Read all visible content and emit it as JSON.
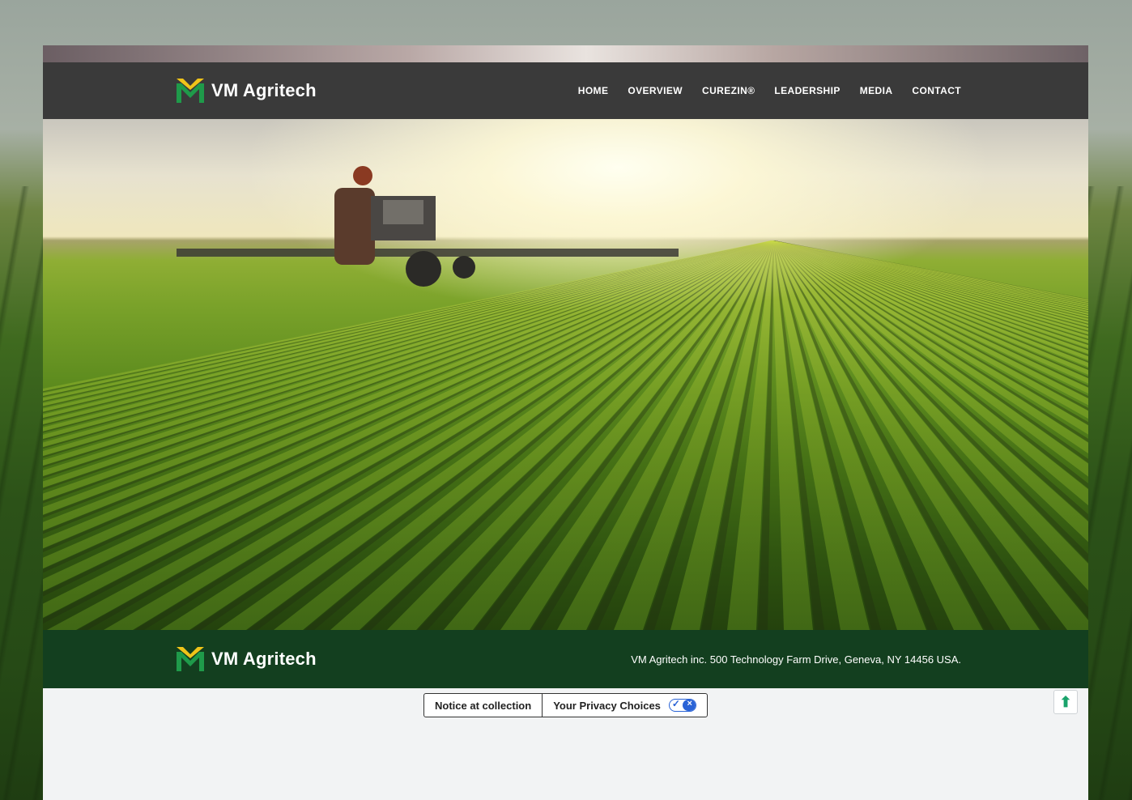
{
  "brand": {
    "name": "VM Agritech",
    "logo_icon": "vm-chevron-logo",
    "colors": {
      "green": "#1f9a4a",
      "yellow": "#f0c419"
    }
  },
  "nav": {
    "items": [
      {
        "label": "HOME"
      },
      {
        "label": "OVERVIEW"
      },
      {
        "label": "CUREZIN®"
      },
      {
        "label": "LEADERSHIP"
      },
      {
        "label": "MEDIA"
      },
      {
        "label": "CONTACT"
      }
    ]
  },
  "hero": {
    "image": "tractor-spraying-soybean-field"
  },
  "footer": {
    "brand_name": "VM Agritech",
    "address": "VM Agritech inc. 500 Technology Farm Drive, Geneva, NY 14456 USA.",
    "background": "#133f1f"
  },
  "privacy": {
    "notice_label": "Notice at collection",
    "choices_label": "Your Privacy Choices",
    "toggle_icon": "privacy-toggle-icon"
  },
  "scroll_top": {
    "icon": "arrow-up-icon",
    "glyph": "⬆"
  }
}
